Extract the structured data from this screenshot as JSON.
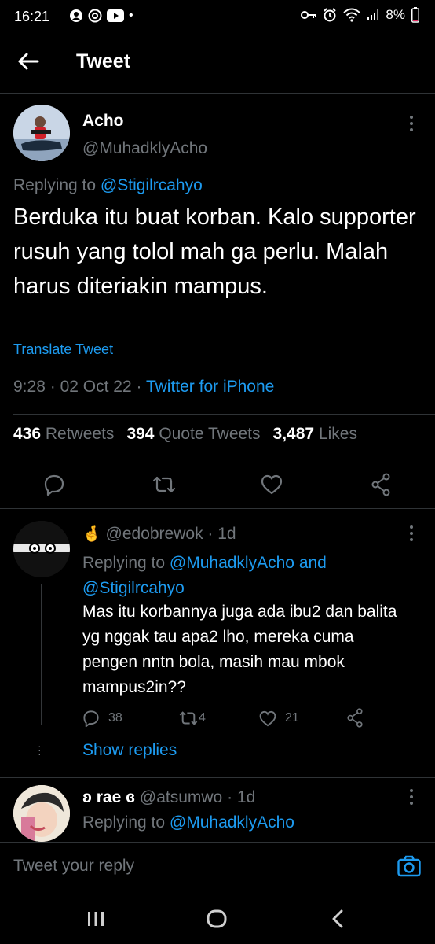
{
  "status_bar": {
    "time": "16:21",
    "battery": "8%"
  },
  "header": {
    "title": "Tweet"
  },
  "main_tweet": {
    "name": "Acho",
    "handle": "@MuhadklyAcho",
    "replying_prefix": "Replying to",
    "replying_to": "@Stigilrcahyo",
    "text": "Berduka itu buat korban. Kalo supporter rusuh yang tolol mah ga perlu. Malah harus diteriakin mampus.",
    "translate": "Translate Tweet",
    "time": "9:28",
    "date": "02 Oct 22",
    "source": "Twitter for iPhone",
    "retweets_count": "436",
    "retweets_label": "Retweets",
    "quotes_count": "394",
    "quotes_label": "Quote Tweets",
    "likes_count": "3,487",
    "likes_label": "Likes"
  },
  "replies": [
    {
      "emoji": "🤞",
      "handle": "@edobrewok",
      "age": "· 1d",
      "replying_prefix": "Replying to",
      "replying_to_1": "@MuhadklyAcho",
      "replying_and": "and",
      "replying_to_2": "@Stigilrcahyo",
      "text": "Mas itu korbannya juga ada ibu2 dan balita yg nggak tau apa2 lho, mereka cuma pengen nntn bola, masih mau mbok mampus2in??",
      "reply_count": "38",
      "retweet_count": "4",
      "like_count": "21",
      "show_replies": "Show replies"
    },
    {
      "name": "ʚ rae ɞ",
      "handle": "@atsumwo",
      "age": "· 1d",
      "replying_prefix": "Replying to",
      "replying_to_1": "@MuhadklyAcho"
    }
  ],
  "reply_bar": {
    "placeholder": "Tweet your reply"
  },
  "icons": {
    "back": "arrow-left-icon",
    "more": "more-vertical-icon",
    "reply": "reply-icon",
    "retweet": "retweet-icon",
    "like": "heart-icon",
    "share": "share-icon",
    "camera": "camera-icon"
  },
  "colors": {
    "accent": "#1d9bf0",
    "background": "#000000",
    "muted": "#71767b"
  }
}
